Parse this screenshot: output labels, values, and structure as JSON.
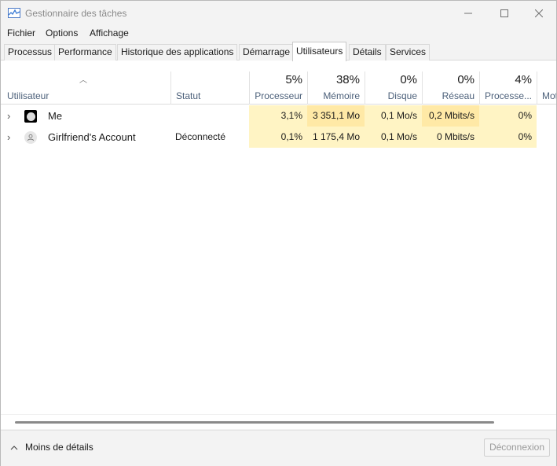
{
  "window": {
    "title": "Gestionnaire des tâches"
  },
  "menu": [
    "Fichier",
    "Options",
    "Affichage"
  ],
  "tabs": [
    {
      "label": "Processus",
      "active": false
    },
    {
      "label": "Performance",
      "active": false
    },
    {
      "label": "Historique des applications",
      "active": false
    },
    {
      "label": "Démarrage",
      "active": false
    },
    {
      "label": "Utilisateurs",
      "active": true
    },
    {
      "label": "Détails",
      "active": false
    },
    {
      "label": "Services",
      "active": false
    }
  ],
  "columns": {
    "user": {
      "label": "Utilisateur"
    },
    "status": {
      "label": "Statut"
    },
    "cpu": {
      "pct": "5%",
      "label": "Processeur"
    },
    "memory": {
      "pct": "38%",
      "label": "Mémoire"
    },
    "disk": {
      "pct": "0%",
      "label": "Disque"
    },
    "network": {
      "pct": "0%",
      "label": "Réseau"
    },
    "gpu": {
      "pct": "4%",
      "label": "Processe..."
    },
    "extra": {
      "label": "Mot"
    }
  },
  "users": [
    {
      "name": "Me",
      "status": "",
      "cpu": "3,1%",
      "memory": "3 351,1 Mo",
      "disk": "0,1 Mo/s",
      "network": "0,2 Mbits/s",
      "gpu": "0%",
      "avatar": "photo"
    },
    {
      "name": "Girlfriend's Account",
      "status": "Déconnecté",
      "cpu": "0,1%",
      "memory": "1 175,4 Mo",
      "disk": "0,1 Mo/s",
      "network": "0 Mbits/s",
      "gpu": "0%",
      "avatar": "generic-user"
    }
  ],
  "footer": {
    "less_details": "Moins de détails",
    "disconnect": "Déconnexion"
  },
  "colors": {
    "heat_light": "#fff4c4",
    "heat_medium": "#ffe9a6",
    "header_label": "#4c607a"
  }
}
